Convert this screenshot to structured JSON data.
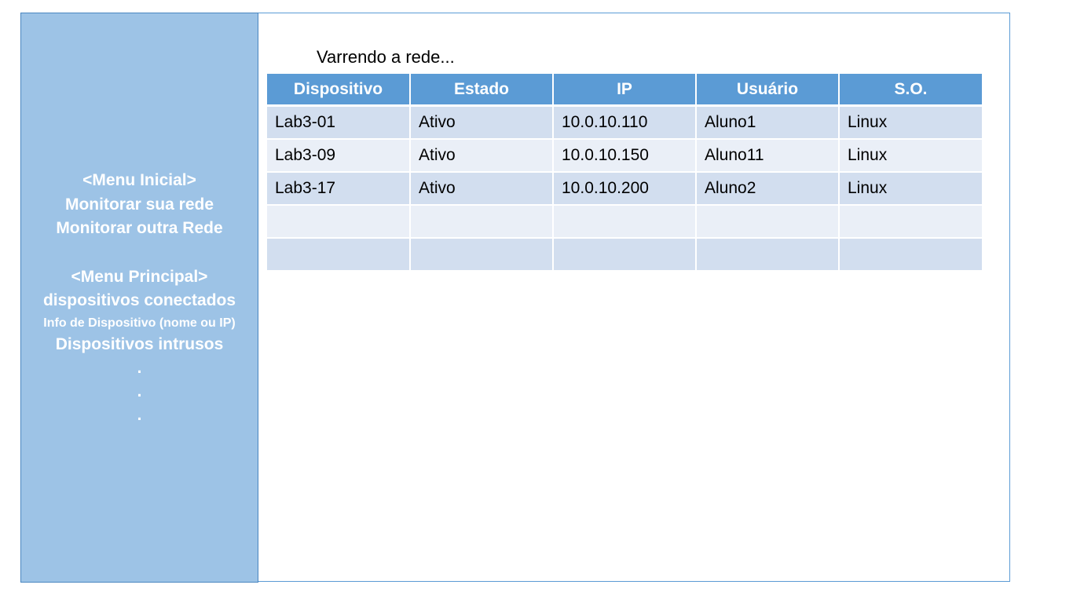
{
  "sidebar": {
    "menu_inicial_header": "<Menu Inicial>",
    "monitorar_sua_rede": "Monitorar sua rede",
    "monitorar_outra_rede": "Monitorar outra Rede",
    "menu_principal_header": "<Menu Principal>",
    "dispositivos_conectados": "dispositivos conectados",
    "info_dispositivo": "Info de Dispositivo (nome ou IP)",
    "dispositivos_intrusos": "Dispositivos intrusos",
    "ellipsis": [
      ".",
      ".",
      "."
    ]
  },
  "main": {
    "status": "Varrendo a rede...",
    "table": {
      "headers": [
        "Dispositivo",
        "Estado",
        "IP",
        "Usuário",
        "S.O."
      ],
      "rows": [
        [
          "Lab3-01",
          "Ativo",
          "10.0.10.110",
          "Aluno1",
          "Linux"
        ],
        [
          "Lab3-09",
          "Ativo",
          "10.0.10.150",
          "Aluno11",
          "Linux"
        ],
        [
          "Lab3-17",
          "Ativo",
          "10.0.10.200",
          "Aluno2",
          "Linux"
        ],
        [
          "",
          "",
          "",
          "",
          ""
        ],
        [
          "",
          "",
          "",
          "",
          ""
        ]
      ]
    }
  },
  "colors": {
    "sidebar_bg": "#9dc3e6",
    "header_bg": "#5b9bd5",
    "row_odd": "#d2deef",
    "row_even": "#eaeff7",
    "frame_border": "#5b9bd5"
  }
}
